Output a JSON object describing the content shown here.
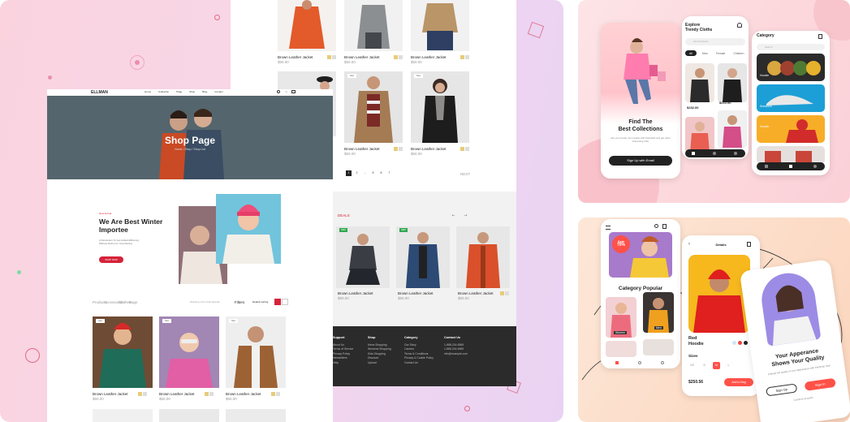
{
  "left_panel": {
    "colors": {
      "accent_red": "#d62339",
      "badge_green": "#2fa84f",
      "hero_bg": "#55656d",
      "footer_bg": "#2b2b2b"
    },
    "top_grid": {
      "products": [
        {
          "name": "Brown Leather Jacket",
          "price": "$50.00",
          "sale": "$48"
        },
        {
          "name": "Brown Leather Jacket",
          "price": "$50.00",
          "sale": "$48"
        },
        {
          "name": "Brown Leather Jacket",
          "price": "$50.00",
          "sale": "$48"
        }
      ],
      "products_row2": [
        {
          "name": "Brown Leather Jacket",
          "price": "$50.00",
          "sale": "$48"
        },
        {
          "name": "Brown Leather Jacket",
          "price": "$50.00",
          "sale": "$48"
        }
      ],
      "pagination": [
        "1",
        "2",
        "...",
        "5",
        "6",
        "7"
      ],
      "next_label": "NEXT"
    },
    "nav": {
      "logo": "ELLMAN",
      "links": [
        "Home",
        "Collection",
        "Page",
        "Shop",
        "Blog",
        "Contact"
      ]
    },
    "hero": {
      "title": "Shop Page",
      "breadcrumb": "Home  /  Shop  /  Shop List"
    },
    "winter": {
      "kicker": "New Arrival",
      "title_line1": "We Are Best Winter",
      "title_line2": "Importee",
      "desc": "A Revolution To Get Added Efficiency Without Ruins For Contributing",
      "button": "SHOP NOW"
    },
    "filters": {
      "tabs": [
        "Products",
        "Accessories",
        "Clothes",
        "Bags"
      ],
      "showing": "Showing 1-12 of 32 Results",
      "filter_label": "Filters",
      "sort_label": "Default sorting"
    },
    "main_grid": [
      {
        "name": "Brown Leather Jacket",
        "price": "$50.00",
        "sale": "$48"
      },
      {
        "name": "Brown Leather Jacket",
        "price": "$50.00",
        "sale": "$48"
      },
      {
        "name": "Brown Leather Jacket",
        "price": "$50.00",
        "sale": "$48"
      }
    ],
    "strip": {
      "label": "DEALS",
      "products": [
        {
          "name": "Brown Leather Jacket",
          "price": "$50.00",
          "sale": "$45"
        },
        {
          "name": "Brown Leather Jacket",
          "price": "$50.00",
          "sale": "$45"
        },
        {
          "name": "Brown Leather Jacket",
          "price": "$50.00",
          "sale": "$45"
        }
      ],
      "badge_new": "NEW",
      "badge_nr": "New"
    },
    "footer": {
      "support": {
        "title": "Support",
        "items": [
          "About Us",
          "Terms of Service",
          "Privacy Policy",
          "Newsletters",
          "Help"
        ]
      },
      "shop": {
        "title": "Shop",
        "items": [
          "Mens Shopping",
          "Womens Shopping",
          "Kids Shopping",
          "Discount",
          "Upload"
        ]
      },
      "category": {
        "title": "Category",
        "items": [
          "Our Story",
          "Careers",
          "Terms & Conditions",
          "Privacy & Cookie Policy",
          "Contact Us"
        ]
      },
      "contact": {
        "title": "Contact Us",
        "items": [
          "1-888-234-6969",
          "1-888-234-6969",
          "info@example.com"
        ]
      }
    }
  },
  "app_top": {
    "onboarding": {
      "title_line1": "Find The",
      "title_line2": "Best Collections",
      "desc": "Get your dream item easily with FashHub and get other interesting offer",
      "button": "Sign Up with Email"
    },
    "explore": {
      "title_line1": "Explore",
      "title_line2": "Trendy Cloths",
      "search_placeholder": "Find Products",
      "tabs": [
        "All",
        "Man",
        "Female",
        "Children"
      ],
      "prices": [
        "$232.00",
        "$210.00"
      ]
    },
    "category": {
      "title": "Category",
      "search_placeholder": "Search",
      "labels": [
        "Hoodie",
        "Sneakers",
        "Hoodie",
        "Sweater"
      ]
    }
  },
  "app_bottom": {
    "home": {
      "sale_line1": "Sale",
      "sale_line2": "70%",
      "section": "Category Popular",
      "items": [
        "Women",
        "Men"
      ]
    },
    "detail": {
      "title": "Details",
      "name_line1": "Red",
      "name_line2": "Hoodie",
      "sizes_label": "Sizes",
      "sizes": [
        "XS",
        "S",
        "M",
        "L"
      ],
      "price": "$250.56",
      "add_button": "Add to Bag"
    },
    "welcome": {
      "title_line1": "Your Apperance",
      "title_line2": "Shows Your Quality",
      "desc": "Change the quality of your appearance with FashHub now!",
      "sign_up": "Sign Up",
      "sign_in": "Sign In",
      "footer": "Continue as guest"
    }
  }
}
